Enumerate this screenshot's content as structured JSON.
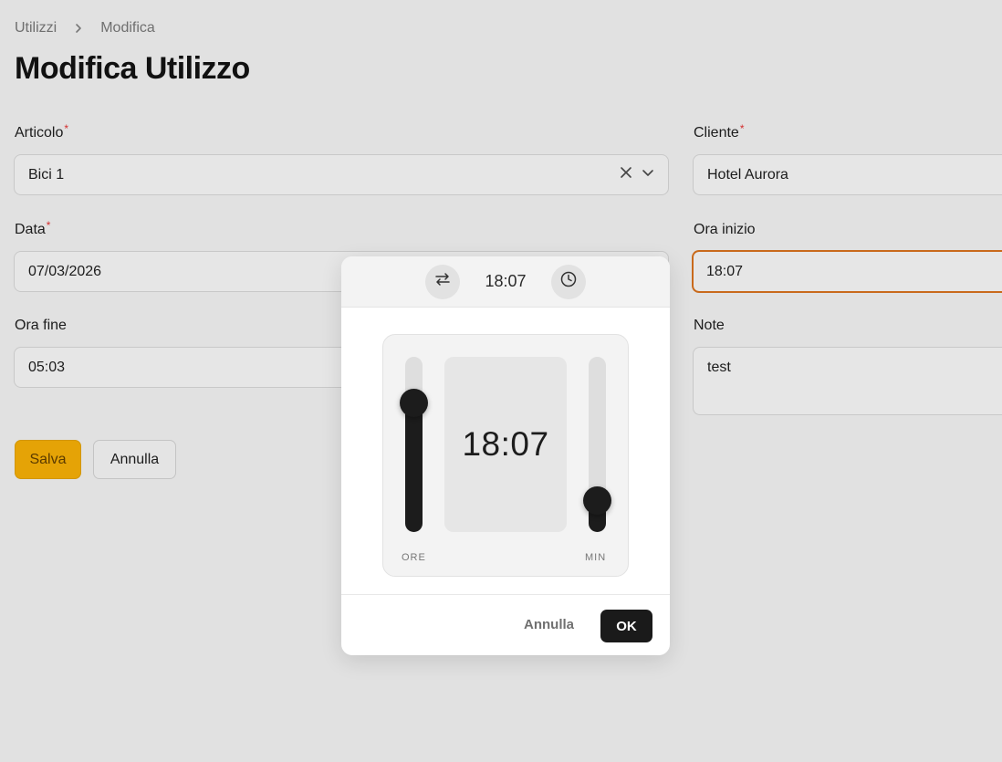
{
  "breadcrumb": {
    "parent": "Utilizzi",
    "current": "Modifica"
  },
  "page": {
    "title": "Modifica Utilizzo"
  },
  "form": {
    "articolo": {
      "label": "Articolo",
      "required": "*",
      "value": "Bici 1"
    },
    "cliente": {
      "label": "Cliente",
      "required": "*",
      "value": "Hotel Aurora"
    },
    "data": {
      "label": "Data",
      "required": "*",
      "value": "07/03/2026"
    },
    "ora_inizio": {
      "label": "Ora inizio",
      "value": "18:07"
    },
    "ora_fine": {
      "label": "Ora fine",
      "value": "05:03"
    },
    "note": {
      "label": "Note",
      "value": "test"
    }
  },
  "actions": {
    "save_label": "Salva",
    "cancel_label": "Annulla"
  },
  "time_picker": {
    "header_time": "18:07",
    "display_time": "18:07",
    "hours_label": "ORE",
    "minutes_label": "MIN",
    "hours_value": 18,
    "minutes_value": 7,
    "cancel_label": "Annulla",
    "ok_label": "OK",
    "icons": {
      "swap": "swap-icon",
      "clock": "clock-icon"
    }
  },
  "colors": {
    "accent": "#e5a306",
    "focus": "#c96a1c",
    "required": "#d32f2f"
  }
}
